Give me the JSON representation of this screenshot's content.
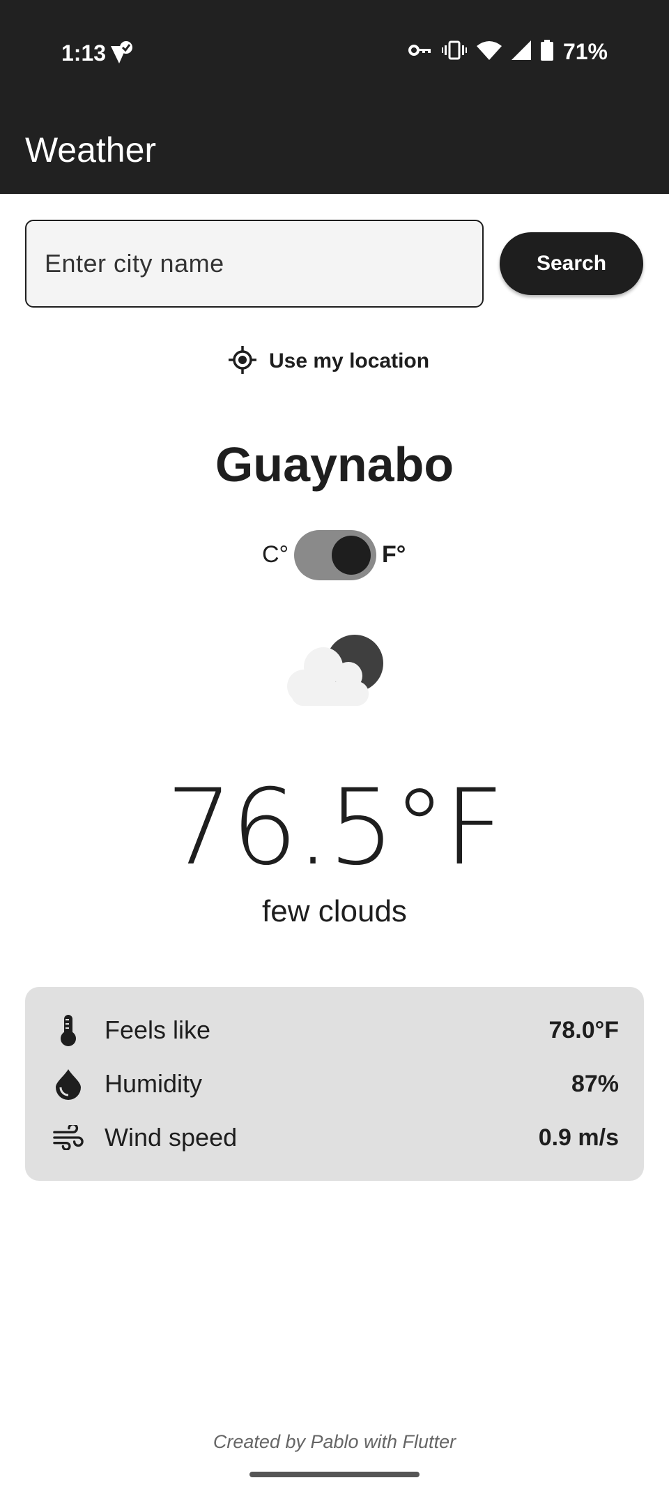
{
  "status_bar": {
    "time": "1:13",
    "battery_percent": "71%",
    "icons": [
      "notification-check-icon",
      "vpn-key-icon",
      "vibrate-icon",
      "wifi-icon",
      "cell-signal-icon",
      "battery-icon"
    ]
  },
  "app_bar": {
    "title": "Weather"
  },
  "search": {
    "placeholder": "Enter city name",
    "value": "",
    "button_label": "Search"
  },
  "location": {
    "label": "Use my location",
    "icon": "my-location-icon"
  },
  "weather": {
    "city": "Guaynabo",
    "unit_toggle": {
      "celsius_label": "C°",
      "fahrenheit_label": "F°",
      "selected": "F"
    },
    "condition_icon": "few-clouds-night-icon",
    "temperature": "76.5°F",
    "description": "few clouds"
  },
  "details": [
    {
      "icon": "thermometer-icon",
      "label": "Feels like",
      "value": "78.0°F"
    },
    {
      "icon": "water-drop-icon",
      "label": "Humidity",
      "value": "87%"
    },
    {
      "icon": "wind-icon",
      "label": "Wind speed",
      "value": "0.9 m/s"
    }
  ],
  "footer": "Created by Pablo with Flutter",
  "colors": {
    "app_bar_bg": "#212121",
    "primary": "#1e1e1e",
    "card_bg": "#e0e0e0",
    "toggle_track": "#8a8a8a"
  }
}
